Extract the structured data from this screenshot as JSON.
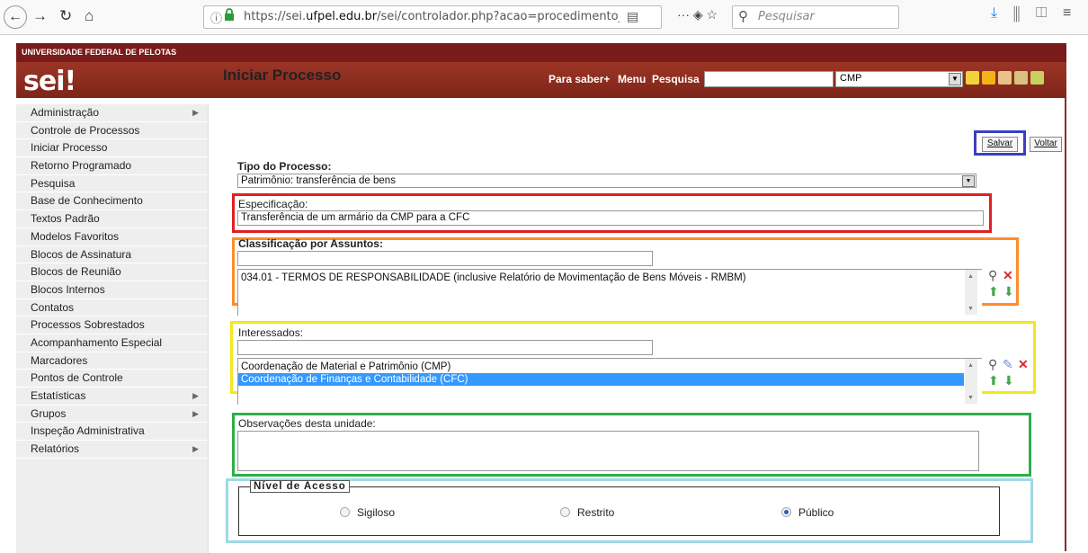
{
  "browser": {
    "url_host": "https://sei.",
    "url_domain": "ufpel.edu.br",
    "url_path": "/sei/controlador.php?acao=procedimento_gerar&a",
    "search_placeholder": "Pesquisar",
    "page_actions_label": "··· ◈ ☆"
  },
  "header": {
    "university": "UNIVERSIDADE FEDERAL DE PELOTAS",
    "logo": "sei!",
    "links": [
      "Para saber+",
      "Menu",
      "Pesquisa"
    ],
    "unit_select": "CMP"
  },
  "menu": {
    "items": [
      {
        "label": "Administração",
        "submenu": true
      },
      {
        "label": "Controle de Processos",
        "submenu": false
      },
      {
        "label": "Iniciar Processo",
        "submenu": false
      },
      {
        "label": "Retorno Programado",
        "submenu": false
      },
      {
        "label": "Pesquisa",
        "submenu": false
      },
      {
        "label": "Base de Conhecimento",
        "submenu": false
      },
      {
        "label": "Textos Padrão",
        "submenu": false
      },
      {
        "label": "Modelos Favoritos",
        "submenu": false
      },
      {
        "label": "Blocos de Assinatura",
        "submenu": false
      },
      {
        "label": "Blocos de Reunião",
        "submenu": false
      },
      {
        "label": "Blocos Internos",
        "submenu": false
      },
      {
        "label": "Contatos",
        "submenu": false
      },
      {
        "label": "Processos Sobrestados",
        "submenu": false
      },
      {
        "label": "Acompanhamento Especial",
        "submenu": false
      },
      {
        "label": "Marcadores",
        "submenu": false
      },
      {
        "label": "Pontos de Controle",
        "submenu": false
      },
      {
        "label": "Estatísticas",
        "submenu": true
      },
      {
        "label": "Grupos",
        "submenu": true
      },
      {
        "label": "Inspeção Administrativa",
        "submenu": false
      },
      {
        "label": "Relatórios",
        "submenu": true
      }
    ]
  },
  "form": {
    "title": "Iniciar Processo",
    "save_label": "Salvar",
    "back_label": "Voltar",
    "tipo_label": "Tipo do Processo:",
    "tipo_value": "Patrimônio: transferência de bens",
    "especificacao_label": "Especificação:",
    "especificacao_value": "Transferência de um armário da CMP para a CFC",
    "classificacao_label": "Classificação por Assuntos:",
    "classificacao_items": [
      "034.01 - TERMOS DE RESPONSABILIDADE (inclusive Relatório de Movimentação de Bens Móveis - RMBM)"
    ],
    "interessados_label": "Interessados:",
    "interessados_items": [
      "Coordenação de Material e Patrimônio (CMP)",
      "Coordenação de Finanças e Contabilidade (CFC)"
    ],
    "observacoes_label": "Observações desta unidade:",
    "nivel_legend": "Nível de Acesso",
    "nivel_options": [
      "Sigiloso",
      "Restrito",
      "Público"
    ],
    "nivel_selected": "Público"
  },
  "colors": {
    "header": "#8a2c22",
    "highlight_blue": "#3b3fbf",
    "highlight_red": "#e02020",
    "highlight_orange": "#ff8c2a",
    "highlight_yellow": "#f5e61a",
    "highlight_green": "#2fae4a",
    "highlight_cyan": "#9fd9e6",
    "selection": "#3399ff"
  }
}
